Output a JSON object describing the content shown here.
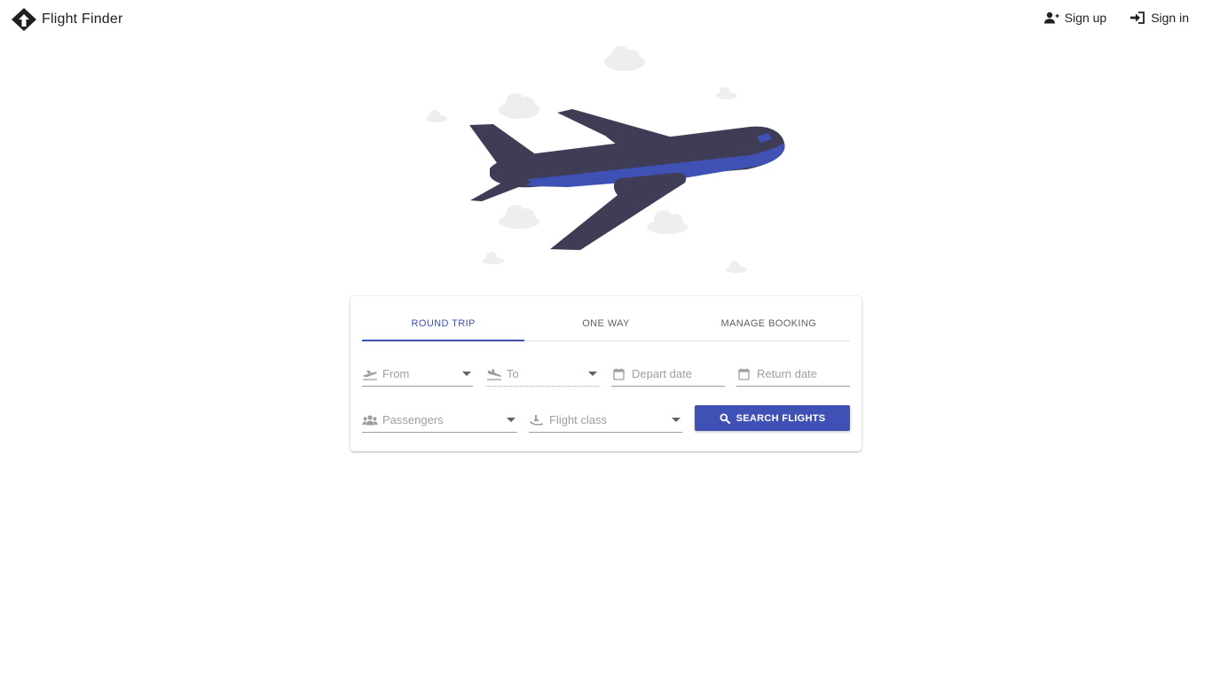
{
  "app": {
    "title": "Flight Finder"
  },
  "header": {
    "signup_label": "Sign up",
    "signin_label": "Sign in"
  },
  "tabs": [
    {
      "label": "ROUND TRIP",
      "active": true
    },
    {
      "label": "ONE WAY",
      "active": false
    },
    {
      "label": "MANAGE BOOKING",
      "active": false
    }
  ],
  "form": {
    "from": {
      "placeholder": "From",
      "icon": "flight-takeoff-icon"
    },
    "to": {
      "placeholder": "To",
      "icon": "flight-land-icon"
    },
    "depart": {
      "placeholder": "Depart date",
      "icon": "calendar-icon"
    },
    "return": {
      "placeholder": "Return date",
      "icon": "calendar-icon"
    },
    "passengers": {
      "placeholder": "Passengers",
      "icon": "people-icon"
    },
    "flight_class": {
      "placeholder": "Flight class",
      "icon": "airline-seat-icon"
    },
    "search_label": "SEARCH FLIGHTS"
  },
  "colors": {
    "accent": "#3f51b5",
    "plane_body": "#3f3d56",
    "plane_stripe": "#3f51b5",
    "cloud": "#f0f0f0"
  }
}
